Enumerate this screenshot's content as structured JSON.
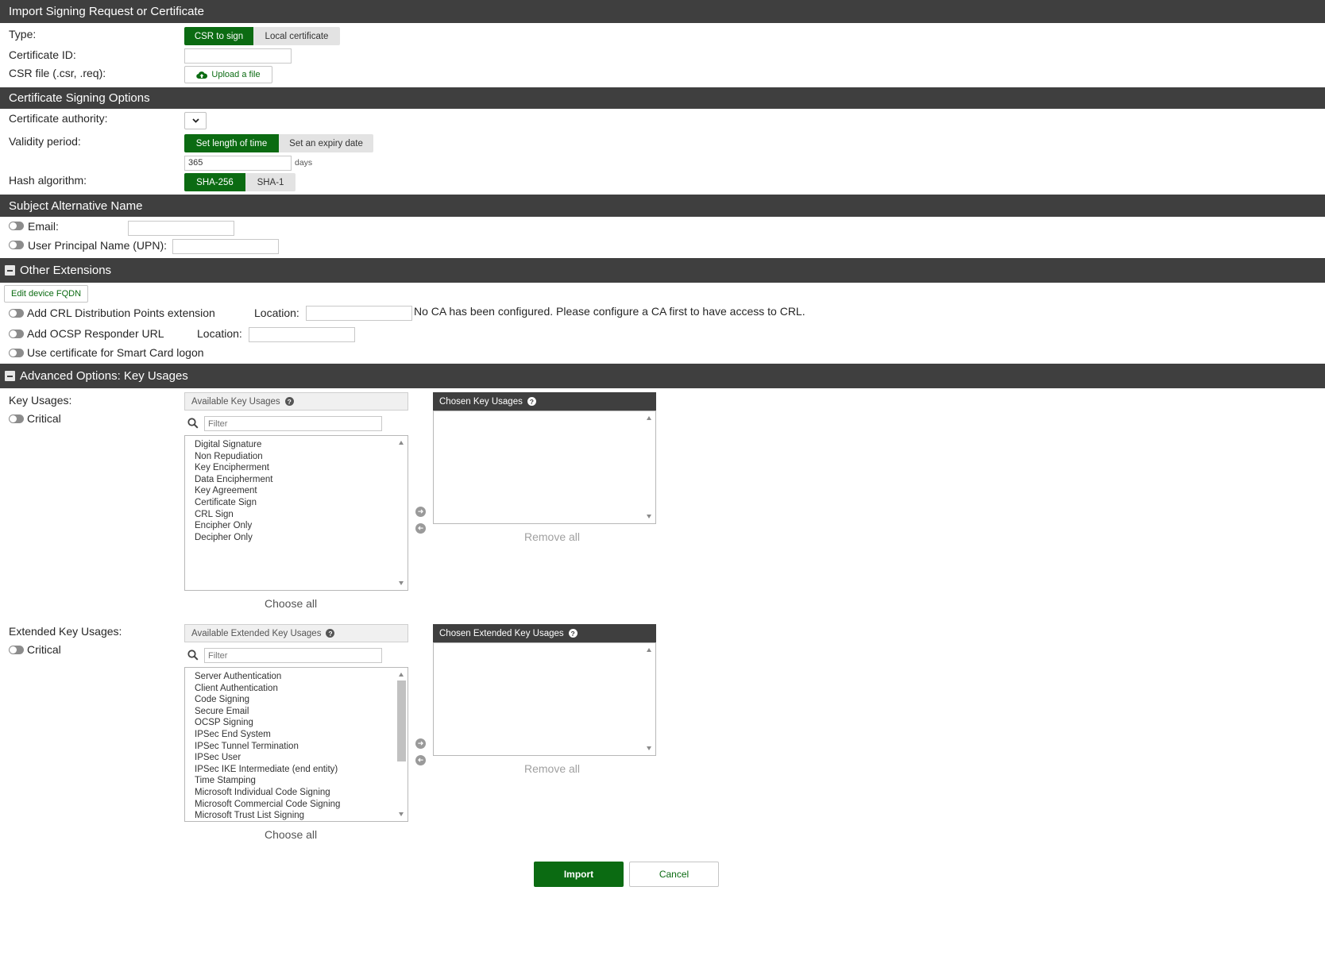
{
  "sections": {
    "import": "Import Signing Request or Certificate",
    "signing": "Certificate Signing Options",
    "san": "Subject Alternative Name",
    "other": "Other Extensions",
    "advanced": "Advanced Options: Key Usages"
  },
  "type": {
    "label": "Type:",
    "options": [
      "CSR to sign",
      "Local certificate"
    ],
    "selected": "CSR to sign"
  },
  "cert_id": {
    "label": "Certificate ID:",
    "value": ""
  },
  "csr_file": {
    "label": "CSR file (.csr, .req):",
    "upload_label": "Upload a file"
  },
  "cert_authority": {
    "label": "Certificate authority:"
  },
  "validity": {
    "label": "Validity period:",
    "options": [
      "Set length of time",
      "Set an expiry date"
    ],
    "value": "365",
    "unit": "days"
  },
  "hash": {
    "label": "Hash algorithm:",
    "options": [
      "SHA-256",
      "SHA-1"
    ]
  },
  "san": {
    "email_label": "Email:",
    "upn_label": "User Principal Name (UPN):"
  },
  "other": {
    "edit_fqdn": "Edit device FQDN",
    "crl_label": "Add CRL Distribution Points extension",
    "crl_location_label": "Location:",
    "crl_note": "No CA has been configured. Please configure a CA first to have access to CRL.",
    "ocsp_label": "Add OCSP Responder URL",
    "ocsp_location_label": "Location:",
    "smartcard_label": "Use certificate for Smart Card logon"
  },
  "key_usages": {
    "label": "Key Usages:",
    "critical_label": "Critical",
    "available_title": "Available Key Usages",
    "chosen_title": "Chosen Key Usages",
    "filter_placeholder": "Filter",
    "items": [
      "Digital Signature",
      "Non Repudiation",
      "Key Encipherment",
      "Data Encipherment",
      "Key Agreement",
      "Certificate Sign",
      "CRL Sign",
      "Encipher Only",
      "Decipher Only"
    ],
    "remove_all": "Remove all",
    "choose_all": "Choose all"
  },
  "ext_key_usages": {
    "label": "Extended Key Usages:",
    "critical_label": "Critical",
    "available_title": "Available Extended Key Usages",
    "chosen_title": "Chosen Extended Key Usages",
    "filter_placeholder": "Filter",
    "items": [
      "Server Authentication",
      "Client Authentication",
      "Code Signing",
      "Secure Email",
      "OCSP Signing",
      "IPSec End System",
      "IPSec Tunnel Termination",
      "IPSec User",
      "IPSec IKE Intermediate (end entity)",
      "Time Stamping",
      "Microsoft Individual Code Signing",
      "Microsoft Commercial Code Signing",
      "Microsoft Trust List Signing"
    ],
    "remove_all": "Remove all",
    "choose_all": "Choose all"
  },
  "actions": {
    "import": "Import",
    "cancel": "Cancel"
  },
  "colors": {
    "accent": "#0b6b12",
    "header": "#3f3f3f"
  },
  "icons": [
    "upload-cloud-icon",
    "chevron-down-icon",
    "collapse-icon",
    "help-icon",
    "search-icon",
    "arrow-right-icon",
    "arrow-left-icon"
  ]
}
